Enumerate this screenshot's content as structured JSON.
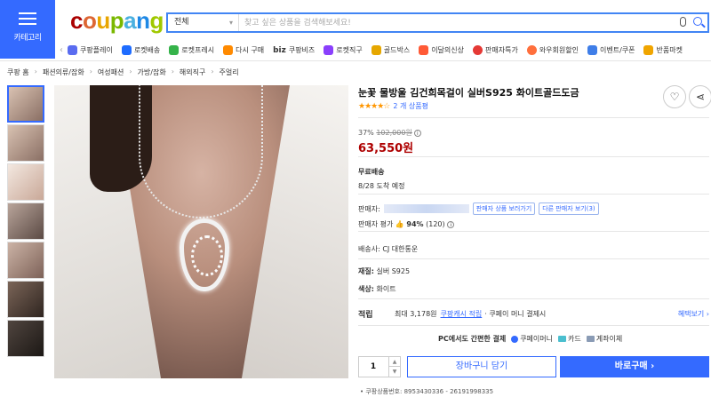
{
  "header": {
    "category_label": "카테고리",
    "logo": [
      "c",
      "o",
      "u",
      "p",
      "a",
      "n",
      "g"
    ],
    "search": {
      "scope": "전체",
      "placeholder": "찾고 싶은 상품을 검색해보세요!"
    },
    "shortcuts": [
      {
        "label": "쿠팡플레이",
        "icon": "play-icon",
        "color": "#5a6cf0"
      },
      {
        "label": "로켓배송",
        "icon": "rocket-icon",
        "color": "#1e6cff"
      },
      {
        "label": "로켓프레시",
        "icon": "rocket-fresh-icon",
        "color": "#35b34a"
      },
      {
        "label": "다시 구매",
        "icon": "rebuy-icon",
        "color": "#ff8a00"
      },
      {
        "label": "쿠팡비즈",
        "prefix": "biz",
        "icon": "biz-icon",
        "color": "#222222"
      },
      {
        "label": "로켓직구",
        "icon": "rocket-global-icon",
        "color": "#8a3ffc"
      },
      {
        "label": "골드박스",
        "icon": "goldbox-icon",
        "color": "#e6a700"
      },
      {
        "label": "이달의신상",
        "icon": "new-icon",
        "color": "#ff5a36"
      },
      {
        "label": "판매자특가",
        "icon": "percent-icon",
        "color": "#e53935"
      },
      {
        "label": "와우회원할인",
        "icon": "wow-icon",
        "color": "#ff6f3c"
      },
      {
        "label": "이벤트/쿠폰",
        "icon": "coupon-icon",
        "color": "#3f7ee8"
      },
      {
        "label": "반품마켓",
        "icon": "return-market-icon",
        "color": "#f0a500"
      }
    ]
  },
  "breadcrumbs": [
    "쿠팡 홈",
    "패션의류/잡화",
    "여성패션",
    "가방/잡화",
    "해외직구",
    "주얼리"
  ],
  "product": {
    "title": "눈꽃 물방울 김건희목걸이 실버S925 화이트골드도금",
    "rating_stars": "★★★★☆",
    "review_count": "2 개 상품평",
    "discount_rate": "37%",
    "original_price": "102,000원",
    "price": "63,550원",
    "shipping": {
      "label": "무료배송",
      "arrival": "8/28 도착 예정"
    },
    "seller": {
      "label": "판매자:",
      "view_products": "판매자 상품 보러가기",
      "other_sellers": "다른 판매자 보기(3)",
      "rating_label": "판매자 평가",
      "rating_value": "94%",
      "rating_count": "(120)"
    },
    "courier": "배송사: CJ 대한통운",
    "material": {
      "label": "재질:",
      "value": "실버 S925"
    },
    "color": {
      "label": "색상:",
      "value": "화이트"
    },
    "benefit": {
      "label": "적립",
      "text_pre": "최대 3,178원",
      "link": "쿠팡캐시 적립",
      "text_post": "· 쿠페이 머니 결제시",
      "more": "혜택보기 ›"
    },
    "pay": {
      "title": "PC에서도 간편한 결제",
      "options": [
        "쿠페이머니",
        "카드",
        "계좌이체"
      ]
    },
    "quantity": "1",
    "cart_label": "장바구니 담기",
    "buy_label": "바로구매 ›",
    "product_number": "• 쿠팡상품번호: 8953430336 - 26191998335"
  }
}
